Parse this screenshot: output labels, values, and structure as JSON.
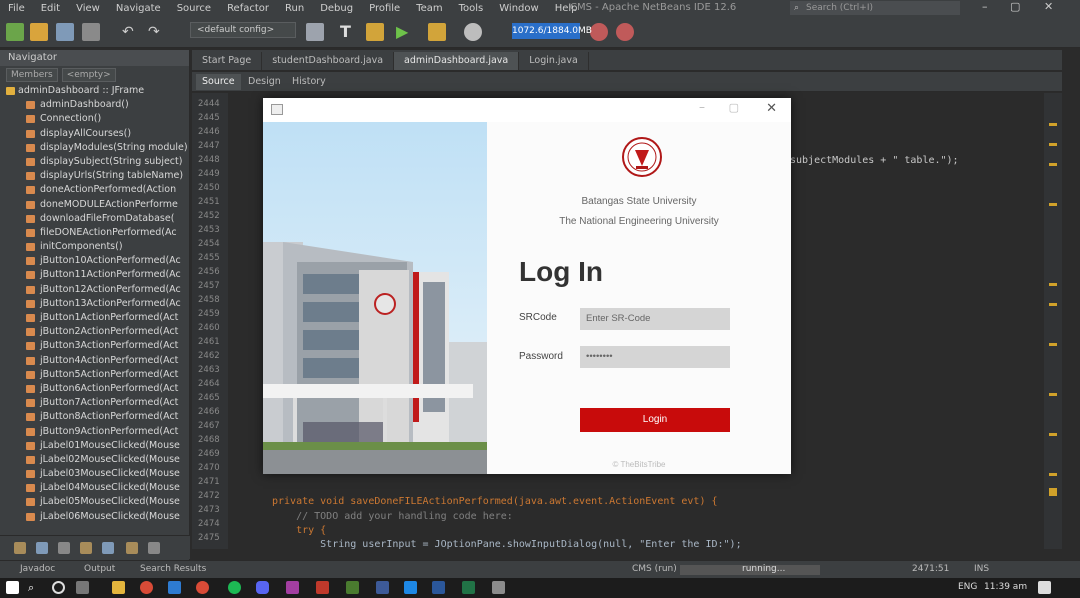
{
  "menu": [
    "File",
    "Edit",
    "View",
    "Navigate",
    "Source",
    "Refactor",
    "Run",
    "Debug",
    "Profile",
    "Team",
    "Tools",
    "Window",
    "Help"
  ],
  "app_title": "CMS - Apache NetBeans IDE 12.6",
  "search": {
    "placeholder": "Search (Ctrl+I)"
  },
  "toolbar": {
    "config": "<default config>",
    "memory": "1072.6/1884.0MB"
  },
  "navigator": {
    "title": "Navigator",
    "filter_members": "Members",
    "filter_empty": "<empty>",
    "root": "adminDashboard :: JFrame",
    "items": [
      "adminDashboard()",
      "Connection()",
      "displayAllCourses()",
      "displayModules(String module)",
      "displaySubject(String subject)",
      "displayUrls(String tableName)",
      "doneActionPerformed(Action",
      "doneMODULEActionPerforme",
      "downloadFileFromDatabase(",
      "fileDONEActionPerformed(Ac",
      "initComponents()",
      "jButton10ActionPerformed(Ac",
      "jButton11ActionPerformed(Ac",
      "jButton12ActionPerformed(Ac",
      "jButton13ActionPerformed(Ac",
      "jButton1ActionPerformed(Act",
      "jButton2ActionPerformed(Act",
      "jButton3ActionPerformed(Act",
      "jButton4ActionPerformed(Act",
      "jButton5ActionPerformed(Act",
      "jButton6ActionPerformed(Act",
      "jButton7ActionPerformed(Act",
      "jButton8ActionPerformed(Act",
      "jButton9ActionPerformed(Act",
      "jLabel01MouseClicked(Mouse",
      "jLabel02MouseClicked(Mouse",
      "jLabel03MouseClicked(Mouse",
      "jLabel04MouseClicked(Mouse",
      "jLabel05MouseClicked(Mouse",
      "jLabel06MouseClicked(Mouse"
    ]
  },
  "tabs": [
    "Start Page",
    "studentDashboard.java",
    "adminDashboard.java",
    "Login.java"
  ],
  "subtabs": [
    "Source",
    "Design",
    "History"
  ],
  "gutter_lines": [
    "2444",
    "2445",
    "2446",
    "2447",
    "2448",
    "2449",
    "2450",
    "2451",
    "2452",
    "2453",
    "2454",
    "2455",
    "2456",
    "2457",
    "2458",
    "2459",
    "2460",
    "2461",
    "2462",
    "2463",
    "2464",
    "2465",
    "2466",
    "2467",
    "2468",
    "2469",
    "2470",
    "2471",
    "2472",
    "2473",
    "2474",
    "2475"
  ],
  "code": {
    "right_fragment": "subjectModules + \" table.\");",
    "line1": "private void saveDoneFILEActionPerformed(java.awt.event.ActionEvent evt) {",
    "line2": "    // TODO add your handling code here:",
    "line3": "    try {",
    "line4": "        String userInput = JOptionPane.showInputDialog(null, \"Enter the ID:\");"
  },
  "dialog": {
    "university": "Batangas State University",
    "tagline": "The National Engineering University",
    "title": "Log In",
    "srcode_label": "SRCode",
    "srcode_placeholder": "Enter SR-Code",
    "password_label": "Password",
    "password_value": "••••••••",
    "login_button": "Login",
    "credit": "© TheBitsTribe"
  },
  "statusbar": {
    "left_tabs": [
      "Javadoc",
      "Output",
      "Search Results"
    ],
    "project": "CMS (run)",
    "running": "running...",
    "position": "2471:51",
    "mode": "INS"
  },
  "taskbar": {
    "lang": "ENG",
    "time": "11:39 am"
  },
  "colors": {
    "accent_red": "#c80b0b",
    "ide_bg": "#2b2b2b",
    "panel_bg": "#3c3f41"
  }
}
